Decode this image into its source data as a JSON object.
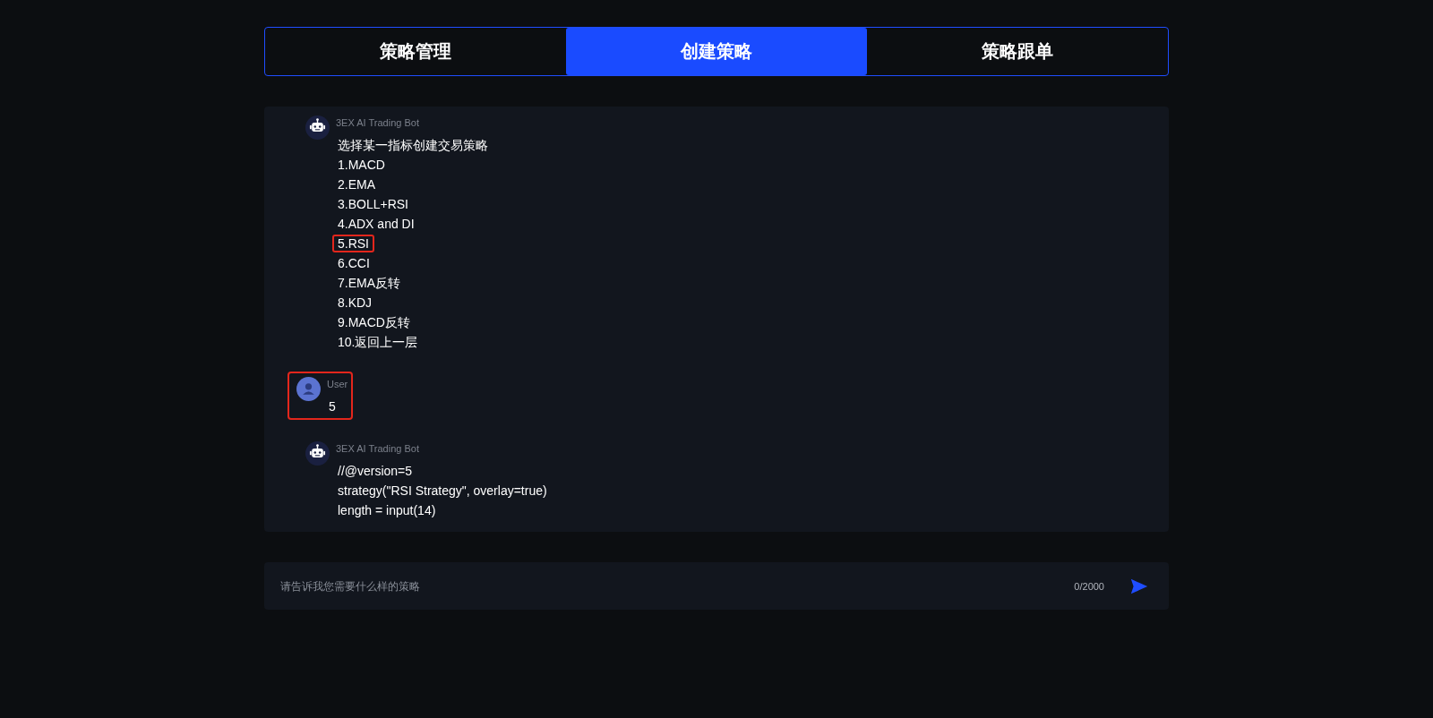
{
  "tabs": [
    {
      "label": "策略管理",
      "selected": false
    },
    {
      "label": "创建策略",
      "selected": true
    },
    {
      "label": "策略跟单"
    }
  ],
  "messages": [
    {
      "kind": "bot",
      "sender": "3EX AI Trading Bot",
      "highlighted": false,
      "lines": [
        {
          "text": "选择某一指标创建交易策略",
          "highlighted": false
        },
        {
          "text": "1.MACD",
          "highlighted": false
        },
        {
          "text": "2.EMA",
          "highlighted": false
        },
        {
          "text": "3.BOLL+RSI",
          "highlighted": false
        },
        {
          "text": "4.ADX and DI",
          "highlighted": false
        },
        {
          "text": "5.RSI",
          "highlighted": true
        },
        {
          "text": "6.CCI",
          "highlighted": false
        },
        {
          "text": "7.EMA反转",
          "highlighted": false
        },
        {
          "text": "8.KDJ",
          "highlighted": false
        },
        {
          "text": "9.MACD反转",
          "highlighted": false
        },
        {
          "text": "10.返回上一层",
          "highlighted": false
        }
      ]
    },
    {
      "kind": "user",
      "sender": "User",
      "highlighted": true,
      "lines": [
        {
          "text": "5",
          "highlighted": false
        }
      ]
    },
    {
      "kind": "bot",
      "sender": "3EX AI Trading Bot",
      "highlighted": false,
      "lines": [
        {
          "text": "//@version=5",
          "highlighted": false
        },
        {
          "text": "strategy(\"RSI Strategy\", overlay=true)",
          "highlighted": false
        },
        {
          "text": "length = input(14)",
          "highlighted": false
        }
      ]
    }
  ],
  "composer": {
    "placeholder": "请告诉我您需要什么样的策略",
    "counter": "0/2000"
  }
}
